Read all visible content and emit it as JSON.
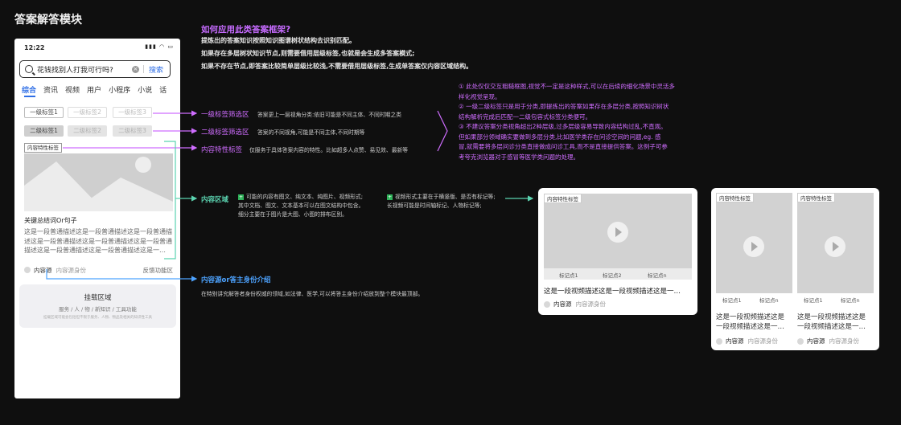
{
  "page_title": "答案解答模块",
  "phone": {
    "time": "12:22",
    "status_icons": "▮▮▮ ◠ ▭",
    "search_query": "花钱找别人打我可行吗?",
    "search_clear": "×",
    "search_button": "搜索",
    "tabs": [
      "综合",
      "资讯",
      "视频",
      "用户",
      "小程序",
      "小说",
      "话"
    ],
    "level1": [
      "一级标签1",
      "一级标签2",
      "一级标签3"
    ],
    "level2": [
      "二级标签1",
      "二级标签2",
      "二级标签3"
    ],
    "feature_tag": "内容特性标签",
    "keyword_title": "关键总结词Or句子",
    "desc": "这是一段普通描述这是一段普通描述这是一段普通描述这是一段普通描述这是一段普通描述这是一段普通描述这是一段普通描述这是一段普通描述这是一…",
    "source": "内容源",
    "source_identity": "内容源身份",
    "feedback": "反馈功能区",
    "mount_title": "挂载区域",
    "mount_sub": "服务 / 人 / 物 / 新知识 / 工具功能",
    "mount_tiny": "挂载区域可能会包括但不限于服务、人物、物品及相关的知识性工具"
  },
  "intro": {
    "heading": "如何应用此类答案框架?",
    "lines": [
      "提炼出的答案知识按照知识图谱树状结构去识别匹配。",
      "如果存在多层树状知识节点,则需要借用层级标签,也就是会生成多答案模式;",
      "如果不存在节点,即答案比较简单层级比较浅,不需要借用层级标签,生成单答案仅内容区域结构。"
    ]
  },
  "labels": {
    "l1": "一级标签筛选区",
    "l1_desc": "答案更上一层视角分类:依旧可能是不同主体、不同时期之类",
    "l2": "二级标签筛选区",
    "l2_desc": "答案的不同视角,可能是不同主体,不同时期等",
    "feat": "内容特性标签",
    "feat_desc": "仅服务于具体答案内容的特性。比如超多人点赞、易见效、最新等",
    "content": "内容区域",
    "content_note1": "可能的内容有图文、纯文本、纯图片、视频形式;其中文档、图文、文本基本可以在图文结构中包含。细分主要在于图片是大图、小图的排布区别。",
    "content_note1_l1": "可能的内容有图文、纯文本、纯图片、视频形式;",
    "content_note1_l2": "其中文档、图文、文本基本可以在图文结构中包含。",
    "content_note1_l3": "细分主要在于图片是大图、小图的排布区别。",
    "content_note2_l1": "视频形式主要在于横竖版、是否有标记等;",
    "content_note2_l2": "长视频可能是时间轴标记、人物标记等;",
    "source": "内容源or答主身份介绍",
    "source_desc": "在特别讲究解答者身份权威的领域,如法律、医学,可以将答主身份介绍放到整个模块最顶部。"
  },
  "notes": [
    "① 此处仅仅交互粗糙框图,视觉不一定是这种样式,可以在后续的细化场景中灵活多样化视觉呈现。",
    "② 一级二级标签只是用于分类,即提炼出的答案如果存在多层分类,按照知识树状结构解析完成后匹配一二级包容式标签分类便可。",
    "③ 不建议答案分类视角超出2种层级,过多层级容易导致内容结构过乱,不直观。但如果部分领域确实要做到多层分类,比如医学类存在问诊空间的问题,eg. 感冒,就需要将多层问诊分类直接做成问诊工具,而不是直接提供答案。这例子可参考夸克浏览器对于感冒等医学类问题的处理。"
  ],
  "notes_lines": [
    "① 此处仅仅交互粗糙框图,视觉不一定是这种样式,可以在后续的细化场景中灵活多",
    "样化视觉呈现。",
    "② 一级二级标签只是用于分类,即提炼出的答案如果存在多层分类,按照知识树状",
    "结构解析完成后匹配一二级包容式标签分类便可。",
    "③ 不建议答案分类视角超出2种层级,过多层级容易导致内容结构过乱,不直观。",
    "但如果部分领域确实要做到多层分类,比如医学类存在问诊空间的问题,eg. 感",
    "冒,就需要将多层问诊分类直接做成问诊工具,而不是直接提供答案。这例子可参",
    "考夸克浏览器对于感冒等医学类问题的处理。"
  ],
  "card1": {
    "tag": "内容特性标签",
    "marks": [
      "标记点1",
      "标记点2",
      "标记点n"
    ],
    "desc": "这是一段视频描述这是一段视频描述这是一…",
    "source": "内容源",
    "identity": "内容源身份"
  },
  "card2": {
    "tag": "内容特性标签",
    "marks": [
      "标记点1",
      "标记点n"
    ],
    "desc_l1": "这是一段视频描述这是",
    "desc_l2": "一段视频描述这是一…",
    "source": "内容源",
    "identity": "内容源身份"
  },
  "colors": {
    "purple": "#c66bff",
    "green": "#5bd3b0",
    "blue": "#4da3ff",
    "link": "#2e6ee6"
  }
}
